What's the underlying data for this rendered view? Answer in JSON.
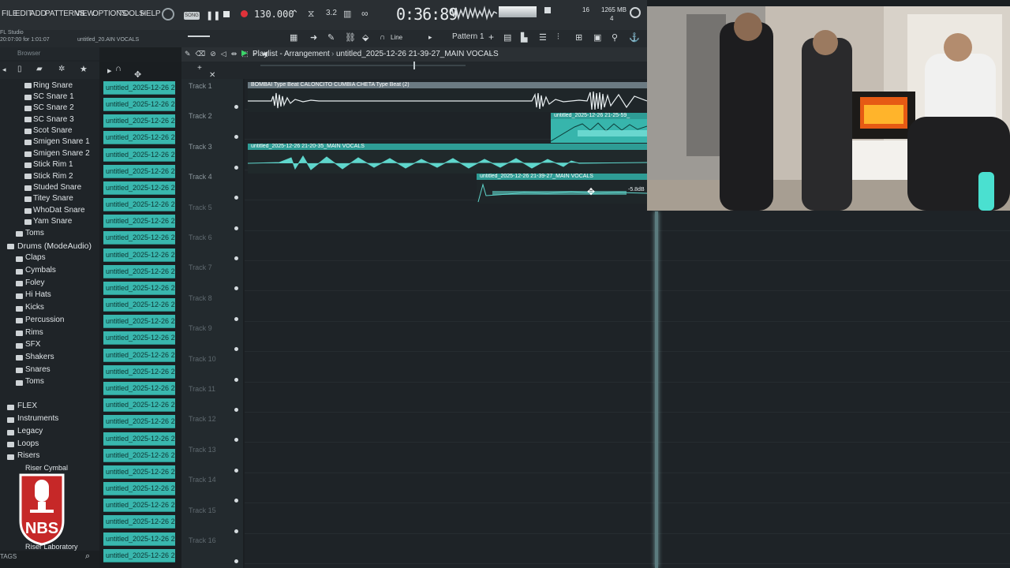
{
  "menu": [
    "FILE",
    "EDIT",
    "ADD",
    "PATTERNS",
    "VIEW",
    "OPTIONS",
    "TOOLS",
    "HELP"
  ],
  "transport": {
    "song_label": "SONG",
    "tempo": "130.000",
    "time": "0:36:89",
    "cpu_label": "16",
    "memory": "1265 MB",
    "voices": "4"
  },
  "hint": {
    "app": "FL Studio",
    "line": "20:07:00 for 1:01:07",
    "file": "untitled_20.AIN VOCALS"
  },
  "toolbar": {
    "snap_label": "Line",
    "pattern_label": "Pattern 1"
  },
  "browser": {
    "title": "Browser",
    "items": [
      "Ring Snare",
      "SC Snare 1",
      "SC Snare 2",
      "SC Snare 3",
      "Scot Snare",
      "Smigen Snare 1",
      "Smigen Snare 2",
      "Stick Rim 1",
      "Stick Rim 2",
      "Studed Snare",
      "Titey Snare",
      "WhoDat Snare",
      "Yam Snare"
    ],
    "toms": "Toms",
    "group": "Drums (ModeAudio)",
    "subfolders": [
      "Claps",
      "Cymbals",
      "Foley",
      "Hi Hats",
      "Kicks",
      "Percussion",
      "Rims",
      "SFX",
      "Shakers",
      "Snares",
      "Toms"
    ],
    "roots": [
      "FLEX",
      "Instruments",
      "Legacy",
      "Loops",
      "Risers"
    ],
    "riser_items": [
      "Riser Cymbal",
      "Riser Laboratory"
    ],
    "tags_label": "TAGS"
  },
  "clip_name": "untitled_2025-12-26 21-...",
  "playlist": {
    "title": "Playlist - Arrangement",
    "current_clip": "untitled_2025-12-26 21-39-27_MAIN VOCALS",
    "tracks": [
      "Track 1",
      "Track 2",
      "Track 3",
      "Track 4",
      "Track 5",
      "Track 6",
      "Track 7",
      "Track 8",
      "Track 9",
      "Track 10",
      "Track 11",
      "Track 12",
      "Track 13",
      "Track 14",
      "Track 15",
      "Track 16"
    ],
    "clips": [
      {
        "name": "BOMBAI Type Beat CALONCITO  CUMBIA CHETA Type Beat (2)"
      },
      {
        "name": "untitled_2025-12-26 21-25-59_"
      },
      {
        "name": "untitled_2025-12-26 21-20-35_MAIN VOCALS"
      },
      {
        "name": "untitled_2025-12-26 21-39-27_MAIN VOCALS"
      }
    ],
    "gain": "-5.8dB"
  },
  "logo_text": "NBS",
  "colors": {
    "clip_teal": "#39b7ae",
    "clip_header": "#2e9c95",
    "audio_white": "#e8eef0"
  }
}
